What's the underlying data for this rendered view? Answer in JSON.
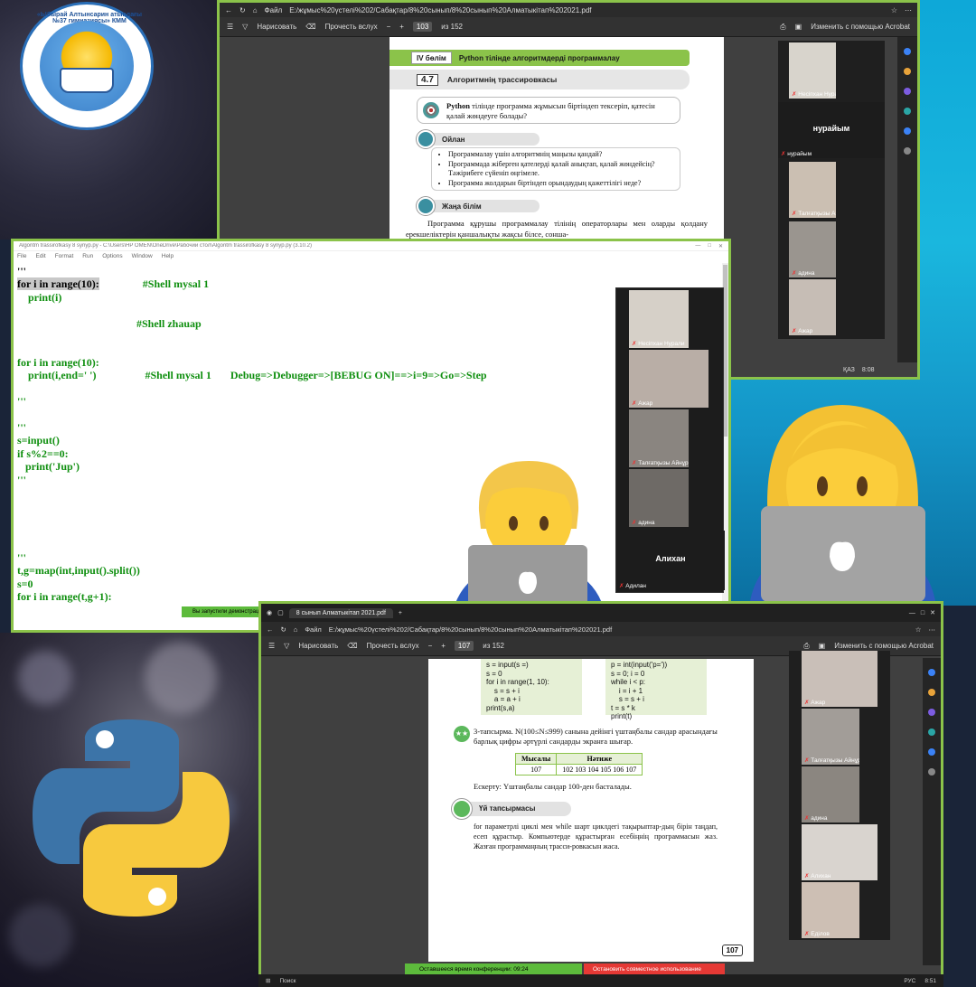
{
  "logo": {
    "arc_top": "«Ыбырай Алтынсарин атындағы №37 гимназиясы» КММ",
    "arc_bottom": ""
  },
  "pdf1": {
    "titlebar": {
      "file_label": "Файл",
      "path": "E:/жұмыс%20үстелі%202/Сабақтар/8%20сынып/8%20сынып%20Алматыкітап%202021.pdf"
    },
    "toolbar": {
      "draw": "Нарисовать",
      "read_aloud": "Прочесть вслух",
      "page": "103",
      "page_total": "из 152",
      "edit_acrobat": "Изменить с помощью Acrobat"
    },
    "doc": {
      "section_tag": "IV бөлім",
      "section_title": "Python тілінде алгоритмдерді программалау",
      "topic_num": "4.7",
      "topic_title": "Алгоритмнің трассировкасы",
      "question_bold": "Python",
      "question_rest": " тілінде программа жұмысын біртіндеп тексеріп, қатесін қалай жөндеуге болады?",
      "think_label": "Ойлан",
      "bullets": [
        "Программалау үшін алгоритмнің маңызы қандай?",
        "Программада жіберген қателерді қалай анықтап, қалай жөндейсің? Тәжірибеге сүйеніп өңгімеле.",
        "Программа жолдарын біртіндеп орындаудың қажеттілігі неде?"
      ],
      "new_knowledge_label": "Жаңа білім",
      "paragraph": "Программа құрушы программалау тілінің операторлары мен оларды қолдану ерекшеліктерін қаншалықты жақсы білсе, сонша-"
    },
    "participants": [
      {
        "name": "Несіпхан Нурали",
        "color": "#d8d4cc"
      },
      {
        "name": "нурайым",
        "big": "нурайым",
        "color": "#1c1c1c"
      },
      {
        "name": "Талғатқызы Айнұр",
        "color": "#cbbfb2"
      },
      {
        "name": "адина",
        "color": "#9a958f"
      },
      {
        "name": "Ажар",
        "color": "#c6bdb5"
      }
    ],
    "status": {
      "lang": "ҚАЗ",
      "time": "8:08"
    }
  },
  "idle": {
    "title": "Algoritm trassirofkasy 8 synyp.py - C:\\Users\\HP OMEN\\OneDrive\\Рабочий стол\\Algoritm trassirofkasy 8 synyp.py (3.10.2)",
    "menu": [
      "File",
      "Edit",
      "Format",
      "Run",
      "Options",
      "Window",
      "Help"
    ],
    "code_lines": [
      {
        "t": "'''",
        "c": "blk"
      },
      {
        "t": "for i in range(10):",
        "c": "hl",
        "tail": "                #Shell mysal 1"
      },
      {
        "t": "    print(i)",
        "c": ""
      },
      {
        "t": "",
        "c": ""
      },
      {
        "t": "                                            #Shell zhauap",
        "c": ""
      },
      {
        "t": "",
        "c": ""
      },
      {
        "t": "",
        "c": ""
      },
      {
        "t": "for i in range(10):",
        "c": ""
      },
      {
        "t": "    print(i,end=' ')                  #Shell mysal 1       Debug=>Debugger=>[BEBUG ON]==>i=9=>Go=>Step",
        "c": ""
      },
      {
        "t": "",
        "c": ""
      },
      {
        "t": "'''",
        "c": ""
      },
      {
        "t": "",
        "c": ""
      },
      {
        "t": "'''",
        "c": ""
      },
      {
        "t": "s=input()",
        "c": ""
      },
      {
        "t": "if s%2==0:",
        "c": ""
      },
      {
        "t": "   print('Jup')",
        "c": ""
      },
      {
        "t": "'''",
        "c": ""
      },
      {
        "t": "",
        "c": ""
      },
      {
        "t": "",
        "c": ""
      },
      {
        "t": "",
        "c": ""
      },
      {
        "t": "",
        "c": ""
      },
      {
        "t": "",
        "c": ""
      },
      {
        "t": "'''",
        "c": ""
      },
      {
        "t": "t,g=map(int,input().split())",
        "c": ""
      },
      {
        "t": "s=0",
        "c": ""
      },
      {
        "t": "for i in range(t,g+1):",
        "c": ""
      }
    ],
    "recording_bar": "Вы запустили демонстрацию",
    "participants": [
      {
        "name": "Несіпхан Нурали",
        "color": "#d6d0c8"
      },
      {
        "name": "Ажар",
        "color": "#b9aea6"
      },
      {
        "name": "Талғатқызы Айнұр",
        "color": "#8a8580"
      },
      {
        "name": "адина",
        "color": "#6e6a66"
      },
      {
        "name": "Адилан",
        "big": "Алихан",
        "color": "#1c1c1c"
      }
    ]
  },
  "pdf2": {
    "tab_title": "8 сынып Алматыкітап 2021.pdf",
    "address": {
      "file_label": "Файл",
      "path": "E:/жұмыс%20үстелі%202/Сабақтар/8%20сынып/8%20сынып%20Алматыкітап%202021.pdf"
    },
    "toolbar": {
      "draw": "Нарисовать",
      "read_aloud": "Прочесть вслух",
      "page": "107",
      "page_total": "из 152",
      "edit_acrobat": "Изменить с помощью Acrobat"
    },
    "doc": {
      "code_left": "s = input(s =)\ns = 0\nfor i in range(1, 10):\n    s = s + i\n    a = a + i\nprint(s,a)",
      "code_right": "p = int(input('p='))\ns = 0; i = 0\nwhile i < p:\n    i = i + 1\n    s = s + i\nt = s * k\nprint(t)",
      "task_icon": "★★",
      "task": "3-тапсырма. N(100≤N≤999) санына дейінгі үштаңбалы сандар арасындағы барлық цифры әртүрлі сандарды экранға шығар.",
      "table": {
        "headers": [
          "Мысалы",
          "Нәтиже"
        ],
        "row": [
          "107",
          "102 103 104 105 106 107"
        ]
      },
      "note": "Ескерту: Үштаңбалы сандар 100-ден басталады.",
      "homework_label": "Үй тапсырмасы",
      "homework_text": "for параметрлі циклі мен while шарт циклдегі тақырыптар-дың бірін таңдап, есеп құрастыр. Компьютерде құрастырған есебіңнің программасын жаз. Жазған программаңның трасси-ровкасын жаса.",
      "page_number": "107"
    },
    "participants": [
      {
        "name": "Ажар",
        "color": "#c9bfb8"
      },
      {
        "name": "Талғатқызы Айнұр",
        "color": "#a29d98"
      },
      {
        "name": "адина",
        "color": "#8b8680"
      },
      {
        "name": "Алихан",
        "color": "#d9d4cf"
      },
      {
        "name": "Еділов",
        "color": "#cdbfb4"
      }
    ],
    "conf_time": "Оставшееся время конференции: 09:24",
    "stop_sharing": "Остановить совместное использование",
    "taskbar_search": "Поиск",
    "taskbar_lang": "РУС",
    "taskbar_time": "8:51"
  },
  "colors": {
    "frame_green": "#8bc34a",
    "python_blue": "#3c74a8",
    "python_yellow": "#f7c93e"
  }
}
